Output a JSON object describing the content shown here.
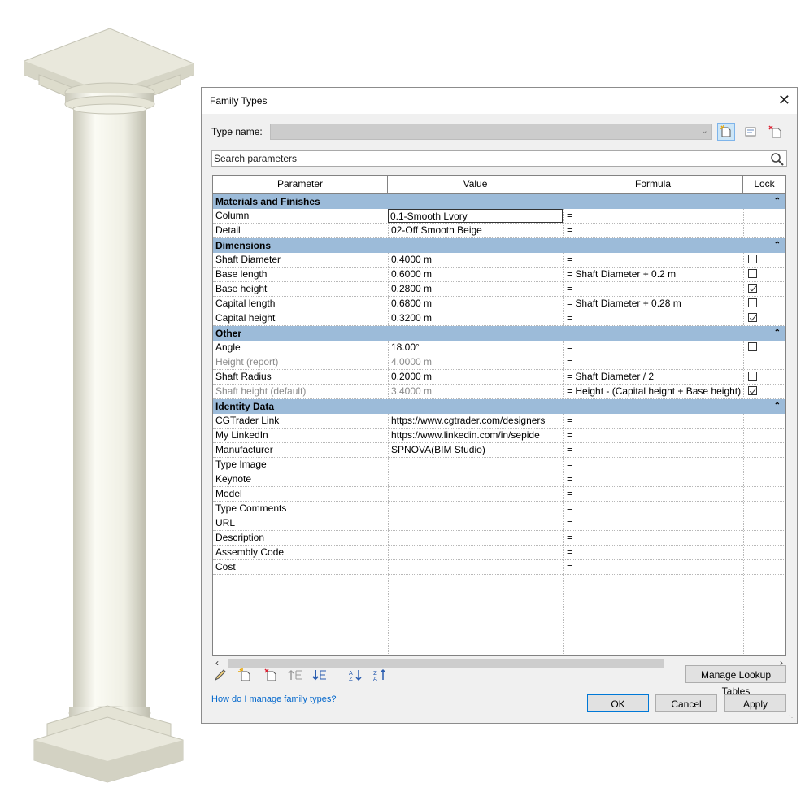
{
  "dialog": {
    "title": "Family Types",
    "close_glyph": "✕",
    "type_name_label": "Type name:",
    "type_name_value": "",
    "search_placeholder": "Search parameters",
    "help_link": "How do I manage family types?",
    "buttons": {
      "manage_lookup": "Manage Lookup Tables",
      "ok": "OK",
      "cancel": "Cancel",
      "apply": "Apply"
    }
  },
  "table": {
    "headers": [
      "Parameter",
      "Value",
      "Formula",
      "Lock"
    ],
    "groups": [
      {
        "name": "Materials and Finishes",
        "rows": [
          {
            "name": "Column",
            "value": "0.1-Smooth Lvory",
            "formula": "=",
            "lock": null,
            "readonly": false,
            "editing": true
          },
          {
            "name": "Detail",
            "value": "02-Off Smooth Beige",
            "formula": "=",
            "lock": null,
            "readonly": false
          }
        ]
      },
      {
        "name": "Dimensions",
        "rows": [
          {
            "name": "Shaft Diameter",
            "value": "0.4000 m",
            "formula": "=",
            "lock": false,
            "readonly": false
          },
          {
            "name": "Base length",
            "value": "0.6000 m",
            "formula": "= Shaft Diameter + 0.2 m",
            "lock": false,
            "readonly": false
          },
          {
            "name": "Base height",
            "value": "0.2800 m",
            "formula": "=",
            "lock": true,
            "readonly": false
          },
          {
            "name": "Capital length",
            "value": "0.6800 m",
            "formula": "= Shaft Diameter + 0.28 m",
            "lock": false,
            "readonly": false
          },
          {
            "name": "Capital height",
            "value": "0.3200 m",
            "formula": "=",
            "lock": true,
            "readonly": false
          }
        ]
      },
      {
        "name": "Other",
        "rows": [
          {
            "name": "Angle",
            "value": "18.00°",
            "formula": "=",
            "lock": false,
            "readonly": false
          },
          {
            "name": "Height (report)",
            "value": "4.0000 m",
            "formula": "=",
            "lock": null,
            "readonly": true
          },
          {
            "name": "Shaft Radius",
            "value": "0.2000 m",
            "formula": "= Shaft Diameter / 2",
            "lock": false,
            "readonly": false
          },
          {
            "name": "Shaft height (default)",
            "value": "3.4000 m",
            "formula": "= Height - (Capital height + Base height)",
            "lock": true,
            "readonly": true
          }
        ]
      },
      {
        "name": "Identity Data",
        "rows": [
          {
            "name": "CGTrader Link",
            "value": "https://www.cgtrader.com/designers",
            "formula": "=",
            "lock": null,
            "readonly": false
          },
          {
            "name": "My LinkedIn",
            "value": "https://www.linkedin.com/in/sepide",
            "formula": "=",
            "lock": null,
            "readonly": false
          },
          {
            "name": "Manufacturer",
            "value": "SPNOVA(BIM Studio)",
            "formula": "=",
            "lock": null,
            "readonly": false
          },
          {
            "name": "Type Image",
            "value": "",
            "formula": "=",
            "lock": null,
            "readonly": false
          },
          {
            "name": "Keynote",
            "value": "",
            "formula": "=",
            "lock": null,
            "readonly": false
          },
          {
            "name": "Model",
            "value": "",
            "formula": "=",
            "lock": null,
            "readonly": false
          },
          {
            "name": "Type Comments",
            "value": "",
            "formula": "=",
            "lock": null,
            "readonly": false
          },
          {
            "name": "URL",
            "value": "",
            "formula": "=",
            "lock": null,
            "readonly": false
          },
          {
            "name": "Description",
            "value": "",
            "formula": "=",
            "lock": null,
            "readonly": false
          },
          {
            "name": "Assembly Code",
            "value": "",
            "formula": "=",
            "lock": null,
            "readonly": false
          },
          {
            "name": "Cost",
            "value": "",
            "formula": "=",
            "lock": null,
            "readonly": false
          }
        ]
      }
    ]
  },
  "colors": {
    "group_header": "#9cbbd9",
    "link": "#0066cc",
    "column_art": "#e9e8dc"
  },
  "icons": {
    "type_toolbar": [
      "new-type-icon",
      "rename-type-icon",
      "delete-type-icon"
    ],
    "search": "magnifier-icon",
    "bottom_toolbar": [
      "edit-parameter-icon",
      "new-parameter-icon",
      "delete-parameter-icon",
      "move-up-icon",
      "move-down-icon",
      "sort-ascending-icon",
      "sort-descending-icon"
    ]
  }
}
